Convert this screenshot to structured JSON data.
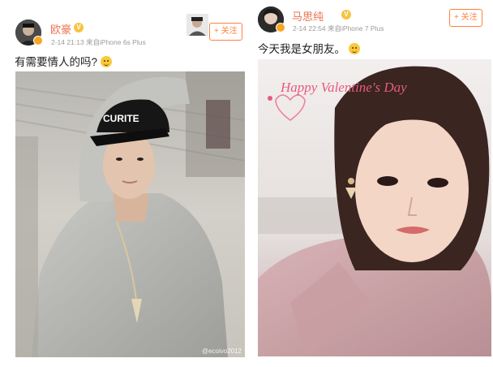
{
  "posts": [
    {
      "username": "欧豪",
      "meta": "2-14 21:13  来自iPhone 6s Plus",
      "follow_label": "+ 关注",
      "text": "有需要情人的吗?",
      "photo_caption": "CURITE",
      "watermark": "@ecoivo2012"
    },
    {
      "username": "马思纯",
      "meta": "2-14 22:54  来自iPhone 7 Plus",
      "follow_label": "+ 关注",
      "text": "今天我是女朋友。",
      "photo_caption": "Happy Valentine's Day"
    }
  ],
  "colors": {
    "username": "#eb7350",
    "follow": "#ff8140",
    "meta": "#9a9a9a"
  },
  "icons": [
    "avatar",
    "verified-badge-icon",
    "vip-icon",
    "smile-emoji-icon"
  ]
}
